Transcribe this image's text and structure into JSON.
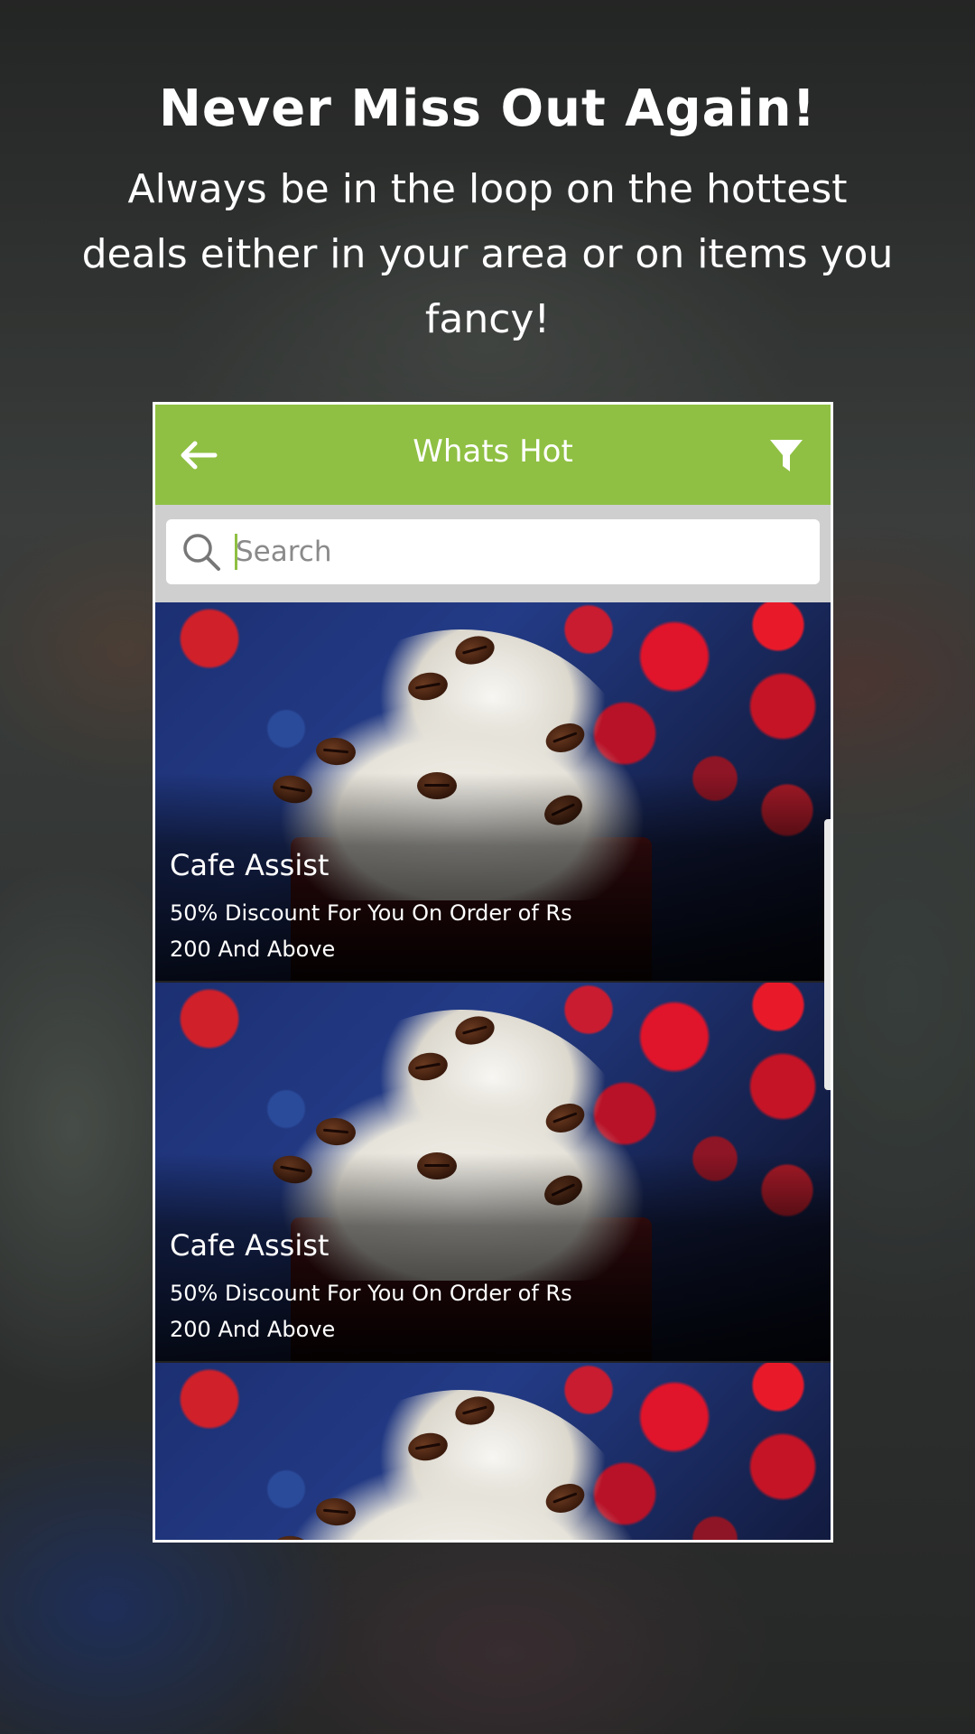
{
  "promo": {
    "headline": "Never Miss Out Again!",
    "subline": "Always be in the loop on the hottest deals either in your area or on items you fancy!"
  },
  "app": {
    "title": "Whats Hot",
    "back_icon": "arrow-left-icon",
    "filter_icon": "filter-icon",
    "accent_color": "#8fc043"
  },
  "search": {
    "placeholder": "Search",
    "value": "",
    "icon": "search-icon"
  },
  "deals": [
    {
      "title": "Cafe Assist",
      "description": "50% Discount For You On Order of Rs 200 And Above"
    },
    {
      "title": "Cafe Assist",
      "description": "50% Discount For You On Order of Rs 200 And Above"
    },
    {
      "title": "",
      "description": ""
    }
  ]
}
